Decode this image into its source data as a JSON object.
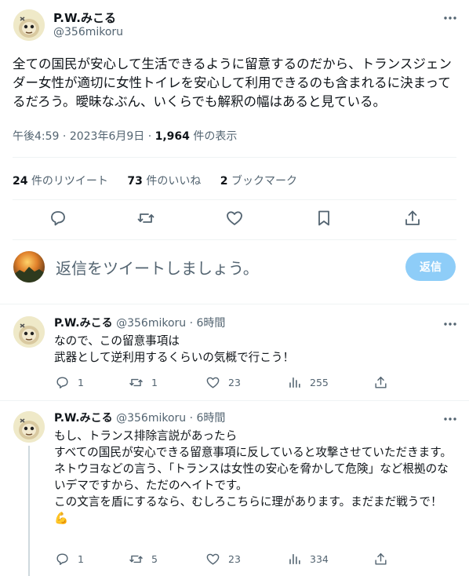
{
  "main_tweet": {
    "display_name": "P.W.みこる",
    "handle": "@356mikoru",
    "text": "全ての国民が安心して生活できるように留意するのだから、トランスジェンダー女性が適切に女性トイレを安心して利用できるのも含まれるに決まってるだろう。曖昧なぶん、いくらでも解釈の幅はあると見ている。",
    "time": "午後4:59",
    "date": "2023年6月9日",
    "views_count": "1,964",
    "views_label": "件の表示",
    "retweets_count": "24",
    "retweets_label": "件のリツイート",
    "likes_count": "73",
    "likes_label": "件のいいね",
    "bookmarks_count": "2",
    "bookmarks_label": "ブックマーク"
  },
  "compose": {
    "placeholder": "返信をツイートしましょう。",
    "reply_button": "返信"
  },
  "replies": [
    {
      "display_name": "P.W.みこる",
      "handle": "@356mikoru",
      "time": "6時間",
      "line1": "なので、この留意事項は",
      "line2": "武器として逆利用するくらいの気概で行こう！",
      "reply_count": "1",
      "retweet_count": "1",
      "like_count": "23",
      "view_count": "255"
    },
    {
      "display_name": "P.W.みこる",
      "handle": "@356mikoru",
      "time": "6時間",
      "line1": "もし、トランス排除言説があったら",
      "line2": "すべての国民が安心できる留意事項に反していると攻撃させていただきます。",
      "line3": "ネトウヨなどの言う、「トランスは女性の安心を脅かして危険」など根拠のないデマですから、ただのヘイトです。",
      "line4": "この文言を盾にするなら、むしろこちらに理があります。まだまだ戦うで！",
      "emoji": "💪",
      "reply_count": "1",
      "retweet_count": "5",
      "like_count": "23",
      "view_count": "334"
    }
  ],
  "icons": {
    "more": "more-icon",
    "reply": "reply-icon",
    "retweet": "retweet-icon",
    "like": "like-icon",
    "bookmark": "bookmark-icon",
    "share": "share-icon",
    "views": "views-icon"
  },
  "colors": {
    "accent": "#1d9bf0",
    "reply_button_disabled": "#8ecdf8",
    "muted_text": "#536471",
    "divider": "#eff3f4"
  }
}
